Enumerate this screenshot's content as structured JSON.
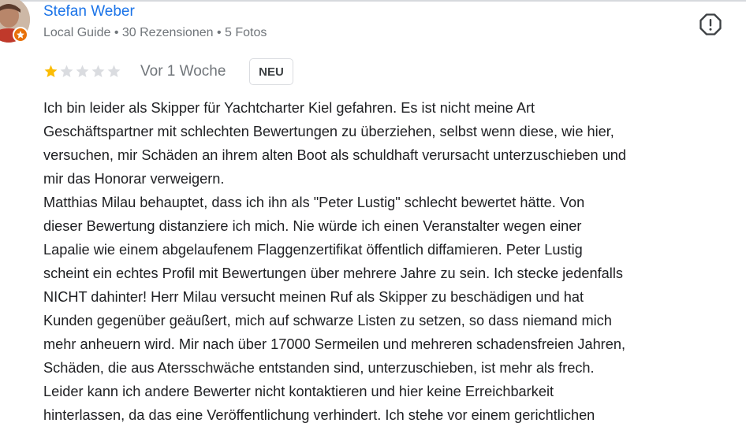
{
  "reviewer": {
    "name": "Stefan Weber",
    "meta": "Local Guide • 30 Rezensionen • 5 Fotos"
  },
  "review": {
    "rating": 1,
    "max_rating": 5,
    "date": "Vor 1 Woche",
    "badge": "NEU",
    "lines": [
      "Ich bin leider als Skipper für Yachtcharter Kiel gefahren. Es ist nicht meine Art",
      "Geschäftspartner mit schlechten Bewertungen zu überziehen, selbst wenn diese, wie hier,",
      "versuchen, mir Schäden an ihrem alten Boot als schuldhaft verursacht unterzuschieben und",
      "mir das Honorar verweigern.",
      "Matthias Milau behauptet, dass ich ihn als \"Peter Lustig\" schlecht bewertet hätte. Von",
      "dieser Bewertung distanziere ich mich. Nie würde ich einen Veranstalter wegen einer",
      "Lapalie wie einem abgelaufenem Flaggenzertifikat öffentlich diffamieren. Peter Lustig",
      "scheint ein echtes Profil mit Bewertungen über mehrere Jahre zu sein. Ich stecke jedenfalls",
      "NICHT dahinter! Herr Milau versucht meinen Ruf als Skipper zu beschädigen und hat",
      "Kunden gegenüber geäußert, mich auf schwarze Listen zu setzen, so dass niemand mich",
      "mehr anheuern wird. Mir nach über 17000 Sermeilen und mehreren schadensfreien Jahren,",
      "Schäden, die aus Atersschwäche entstanden sind, unterzuschieben, ist mehr als frech.",
      "Leider kann ich andere Bewerter nicht kontaktieren und hier keine Erreichbarkeit",
      "hinterlassen, da das eine Veröffentlichung verhindert. Ich stehe vor einem gerichtlichen"
    ]
  },
  "icons": {
    "avatar": "avatar-photo",
    "badge": "local-guide-star-icon",
    "flag": "report-flag-icon",
    "star_filled": "star-filled-icon",
    "star_empty": "star-empty-icon"
  },
  "colors": {
    "name": "#1a73e8",
    "meta": "#70757a",
    "star_filled": "#fbbc04",
    "star_empty": "#dadce0",
    "local_guide_badge": "#e8710a",
    "text": "#202124"
  }
}
